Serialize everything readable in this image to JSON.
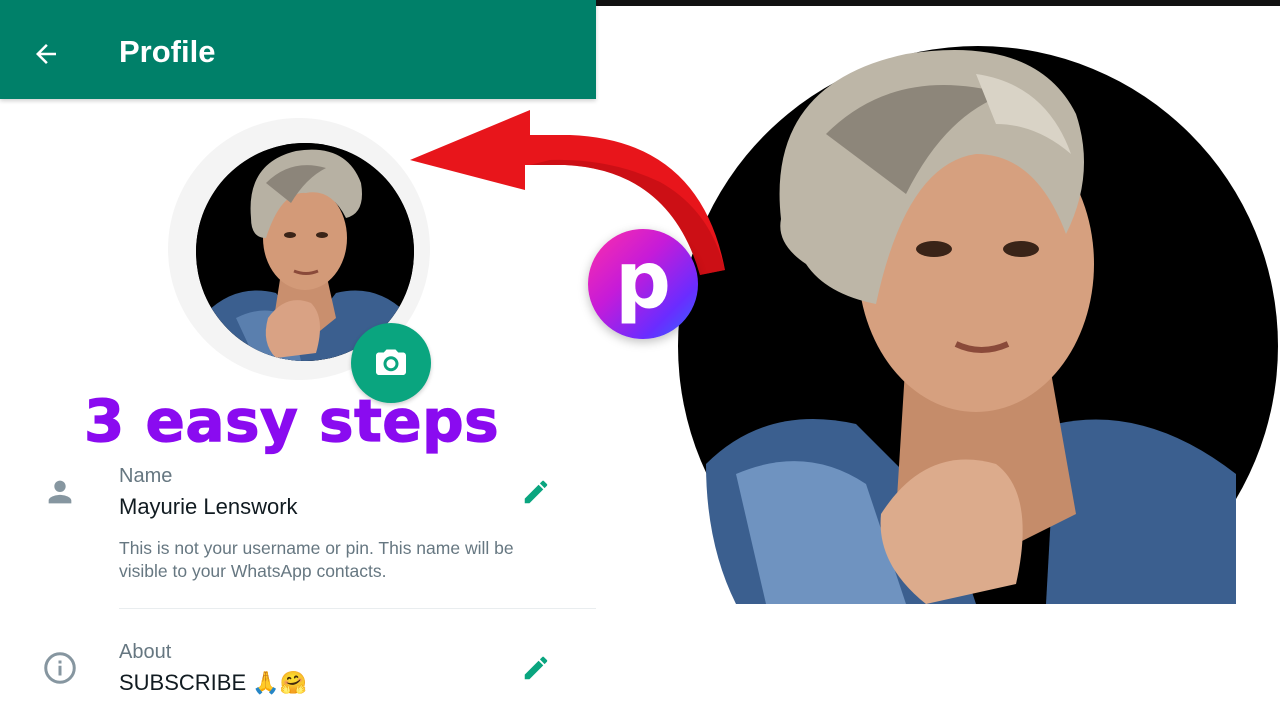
{
  "appbar": {
    "title": "Profile",
    "back_icon": "arrow-left-icon",
    "color": "#008069"
  },
  "profile": {
    "camera_icon": "camera-icon",
    "camera_color": "#0aa57f"
  },
  "overlay": {
    "headline": "3 easy steps",
    "headline_color": "#8a0bf0",
    "logo_letter": "p",
    "arrow_color": "#e8151b"
  },
  "name_row": {
    "icon": "person-icon",
    "label": "Name",
    "value": "Mayurie Lenswork",
    "hint": "This is not your username or pin. This name will be visible to your WhatsApp contacts.",
    "edit_icon": "pencil-icon"
  },
  "about_row": {
    "icon": "info-icon",
    "label": "About",
    "value": "SUBSCRIBE 🙏🤗",
    "edit_icon": "pencil-icon"
  }
}
